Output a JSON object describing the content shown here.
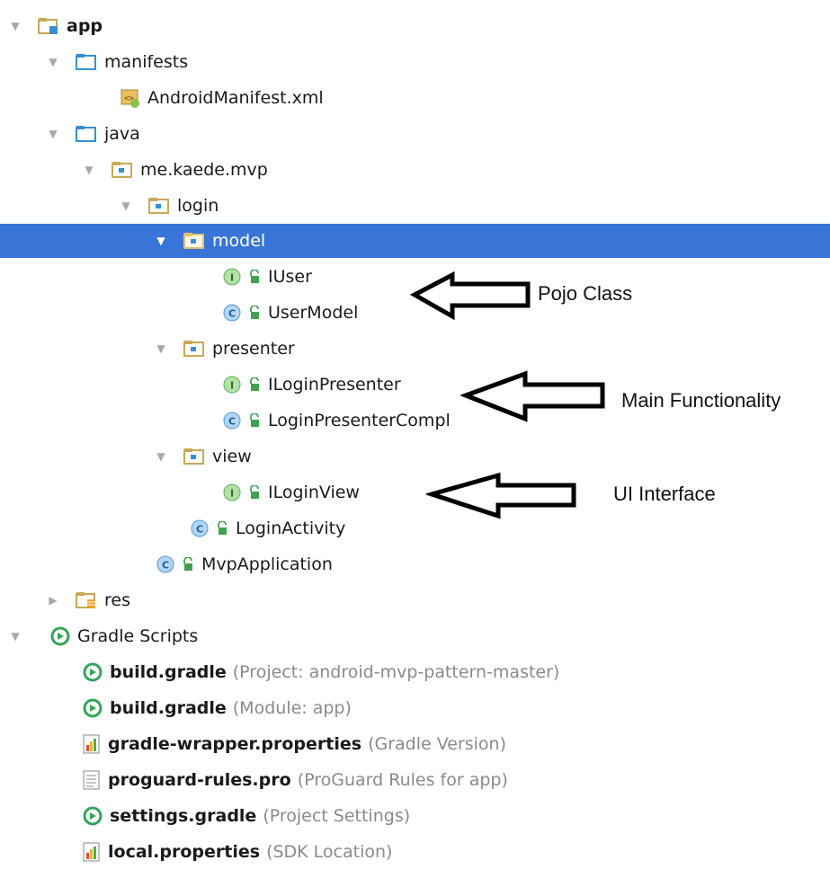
{
  "colors": {
    "selection": "#3875d7",
    "folder_blue": "#3a8fd1",
    "folder_tan": "#c9a857",
    "interface_green": "#59b256",
    "class_blue": "#4c9ad6",
    "gradle_green": "#33a55a"
  },
  "tree": {
    "app": "app",
    "manifests": "manifests",
    "android_manifest": "AndroidManifest.xml",
    "java": "java",
    "package": "me.kaede.mvp",
    "login": "login",
    "model": "model",
    "iuser": "IUser",
    "user_model": "UserModel",
    "presenter": "presenter",
    "ilogin_presenter": "ILoginPresenter",
    "login_presenter_compl": "LoginPresenterCompl",
    "view": "view",
    "ilogin_view": "ILoginView",
    "login_activity": "LoginActivity",
    "mvp_application": "MvpApplication",
    "res": "res",
    "gradle_scripts": "Gradle Scripts",
    "build_gradle_project": "build.gradle",
    "build_gradle_project_hint": "(Project: android-mvp-pattern-master)",
    "build_gradle_module": "build.gradle",
    "build_gradle_module_hint": "(Module: app)",
    "gradle_wrapper": "gradle-wrapper.properties",
    "gradle_wrapper_hint": "(Gradle Version)",
    "proguard": "proguard-rules.pro",
    "proguard_hint": "(ProGuard Rules for app)",
    "settings_gradle": "settings.gradle",
    "settings_gradle_hint": "(Project Settings)",
    "local_properties": "local.properties",
    "local_properties_hint": "(SDK Location)"
  },
  "annotations": {
    "pojo": "Pojo Class",
    "main": "Main Functionality",
    "ui": "UI Interface"
  },
  "icon_letters": {
    "interface": "I",
    "class": "C"
  }
}
